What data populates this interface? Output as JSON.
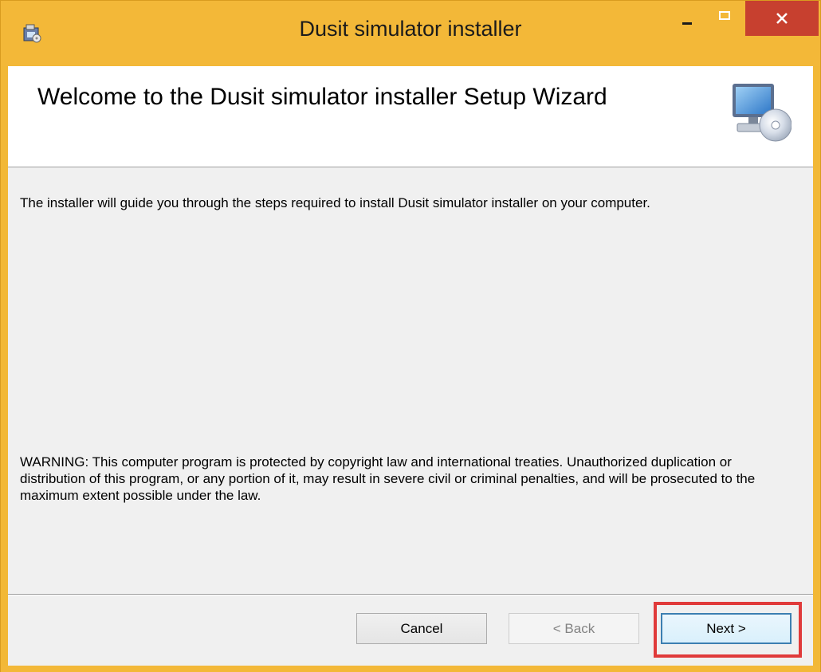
{
  "window": {
    "title": "Dusit simulator installer",
    "accent_color": "#f3b838",
    "close_color": "#c7402f"
  },
  "titlebar": {
    "app_icon": "installer-icon",
    "minimize_icon": "minimize-icon",
    "maximize_icon": "maximize-icon",
    "close_icon": "close-icon",
    "close_glyph": "✕"
  },
  "header": {
    "title": "Welcome to the Dusit simulator installer Setup Wizard",
    "icon": "computer-cd-icon"
  },
  "content": {
    "intro": "The installer will guide you through the steps required to install Dusit simulator installer on your computer.",
    "warning": "WARNING: This computer program is protected by copyright law and international treaties. Unauthorized duplication or distribution of this program, or any portion of it, may result in severe civil or criminal penalties, and will be prosecuted to the maximum extent possible under the law."
  },
  "footer": {
    "cancel_label": "Cancel",
    "back_label": "< Back",
    "next_label": "Next >",
    "highlight_color": "#e03a3a"
  }
}
